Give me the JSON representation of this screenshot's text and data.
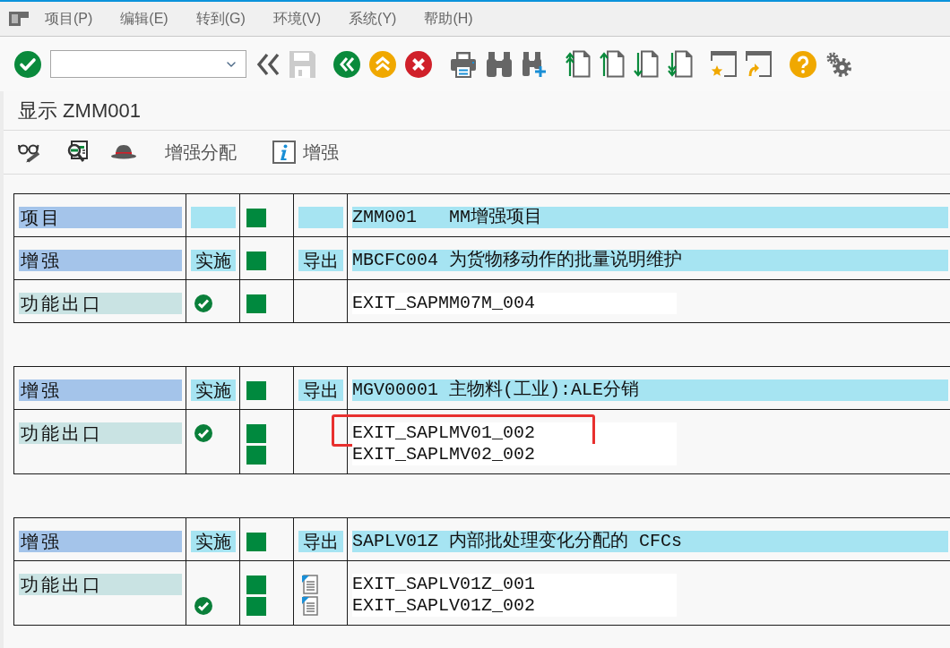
{
  "menu_bar": {
    "items": [
      {
        "label": "项目(P)"
      },
      {
        "label": "编辑(E)"
      },
      {
        "label": "转到(G)"
      },
      {
        "label": "环境(V)"
      },
      {
        "label": "系统(Y)"
      },
      {
        "label": "帮助(H)"
      }
    ]
  },
  "toolbar": {
    "groups": [
      [
        {
          "kind": "enter",
          "disabled": false
        },
        {
          "kind": "command_field",
          "disabled": false
        },
        {
          "kind": "toggle_field",
          "disabled": false
        },
        {
          "kind": "save",
          "disabled": true
        }
      ],
      [
        {
          "kind": "back",
          "disabled": false
        },
        {
          "kind": "exit",
          "disabled": false
        },
        {
          "kind": "cancel",
          "disabled": false
        }
      ],
      [
        {
          "kind": "print",
          "disabled": false
        },
        {
          "kind": "find",
          "disabled": false
        },
        {
          "kind": "find_next",
          "disabled": false
        }
      ],
      [
        {
          "kind": "first_page",
          "disabled": false
        },
        {
          "kind": "previous_page",
          "disabled": false
        },
        {
          "kind": "next_page",
          "disabled": false
        },
        {
          "kind": "last_page",
          "disabled": false
        }
      ],
      [
        {
          "kind": "new_session",
          "disabled": false
        },
        {
          "kind": "shortcut",
          "disabled": false
        }
      ],
      [
        {
          "kind": "help",
          "disabled": false
        },
        {
          "kind": "settings",
          "disabled": false
        }
      ]
    ]
  },
  "title": "显示 ZMM001",
  "app_toolbar": {
    "buttons": [
      {
        "kind": "display_change"
      },
      {
        "kind": "display_object"
      },
      {
        "kind": "hat"
      },
      {
        "kind": "text",
        "label": "增强分配"
      },
      {
        "kind": "info",
        "label": "增强"
      }
    ]
  },
  "blocks": [
    {
      "rows": [
        {
          "kind": "object",
          "object_type": "项目",
          "active": true,
          "description": "ZMM001   MM增强项目"
        },
        {
          "kind": "object",
          "object_type": "增强",
          "status": "实施",
          "active": true,
          "direction": "导出",
          "description": "MBCFC004 为货物移动作的批量说明维护"
        },
        {
          "kind": "exits",
          "object_type": "功能出口",
          "exits": [
            {
              "name": "EXIT_SAPMM07M_004",
              "implemented": true,
              "active": true,
              "documented": false,
              "highlighted": false
            }
          ]
        }
      ]
    },
    {
      "rows": [
        {
          "kind": "object",
          "object_type": "增强",
          "status": "实施",
          "active": true,
          "direction": "导出",
          "description": "MGV00001 主物料(工业):ALE分销"
        },
        {
          "kind": "exits",
          "object_type": "功能出口",
          "exits": [
            {
              "name": "EXIT_SAPLMV01_002",
              "implemented": true,
              "active": true,
              "documented": false,
              "highlighted": true
            },
            {
              "name": "EXIT_SAPLMV02_002",
              "implemented": false,
              "active": true,
              "documented": false,
              "highlighted": false
            }
          ]
        }
      ]
    },
    {
      "rows": [
        {
          "kind": "object",
          "object_type": "增强",
          "status": "实施",
          "active": true,
          "direction": "导出",
          "description": "SAPLV01Z 内部批处理变化分配的 CFCs"
        },
        {
          "kind": "exits",
          "object_type": "功能出口",
          "exits": [
            {
              "name": "EXIT_SAPLV01Z_001",
              "implemented": false,
              "active": true,
              "documented": true,
              "highlighted": false
            },
            {
              "name": "EXIT_SAPLV01Z_002",
              "implemented": true,
              "active": true,
              "documented": true,
              "highlighted": false
            }
          ]
        }
      ]
    }
  ]
}
